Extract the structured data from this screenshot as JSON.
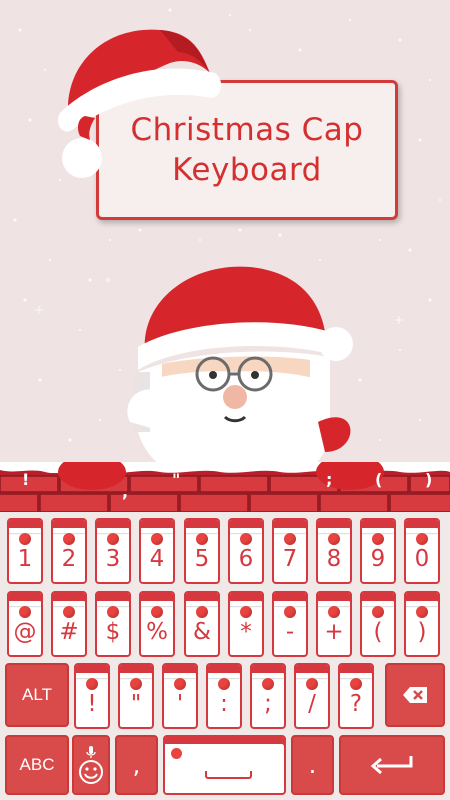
{
  "title": {
    "line1": "Christmas Cap",
    "line2": "Keyboard"
  },
  "brick_punctuation": [
    "!",
    "\"",
    ",",
    ";",
    "(",
    ")"
  ],
  "rows": {
    "numbers": [
      "1",
      "2",
      "3",
      "4",
      "5",
      "6",
      "7",
      "8",
      "9",
      "0"
    ],
    "symbols": [
      "@",
      "#",
      "$",
      "%",
      "&",
      "*",
      "-",
      "+",
      "(",
      ")"
    ],
    "third": [
      "!",
      "\"",
      "'",
      ":",
      ";",
      "/",
      "?"
    ]
  },
  "keys": {
    "alt_label": "ALT",
    "abc_label": "ABC",
    "comma_label": ",",
    "period_label": "."
  },
  "icons": {
    "backspace": "backspace-icon",
    "enter": "enter-arrow-icon",
    "emoji": "emoji-icon",
    "mic": "microphone-icon"
  },
  "colors": {
    "accent": "#d6383f",
    "background": "#efe3e3"
  }
}
